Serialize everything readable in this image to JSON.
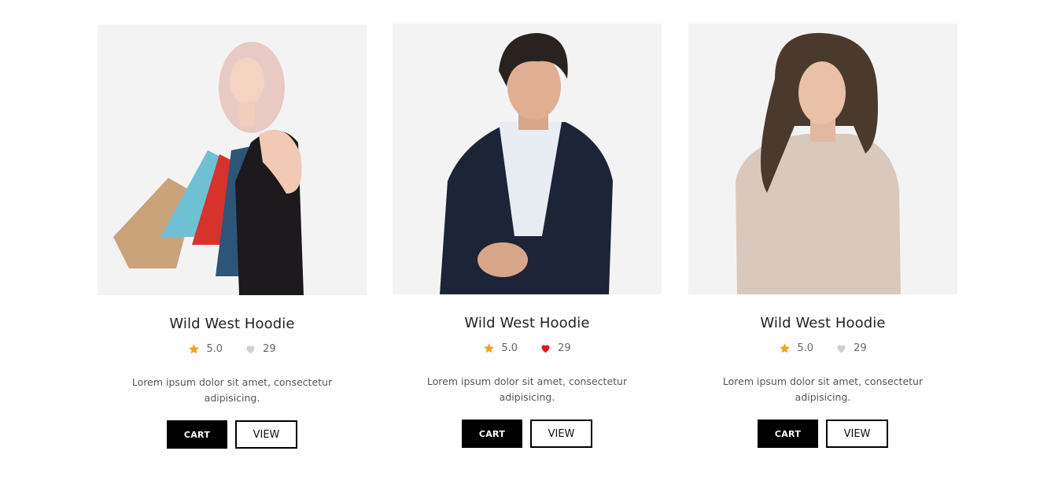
{
  "products": [
    {
      "title": "Wild West Hoodie",
      "rating": "5.0",
      "likes": "29",
      "liked": false,
      "description": "Lorem ipsum dolor sit amet, consectetur adipisicing.",
      "cart_label": "CART",
      "view_label": "VIEW",
      "image_icon": "woman-with-shopping-bags-photo"
    },
    {
      "title": "Wild West Hoodie",
      "rating": "5.0",
      "likes": "29",
      "liked": true,
      "description": "Lorem ipsum dolor sit amet, consectetur adipisicing.",
      "cart_label": "CART",
      "view_label": "VIEW",
      "image_icon": "man-in-suit-photo"
    },
    {
      "title": "Wild West Hoodie",
      "rating": "5.0",
      "likes": "29",
      "liked": false,
      "description": "Lorem ipsum dolor sit amet, consectetur adipisicing.",
      "cart_label": "CART",
      "view_label": "VIEW",
      "image_icon": "woman-in-sweater-photo"
    }
  ],
  "colors": {
    "star": "#f5a21a",
    "heart_liked": "#e8141b",
    "heart_default": "#cfcfcf",
    "photo_bg": "#f4f3f4"
  }
}
